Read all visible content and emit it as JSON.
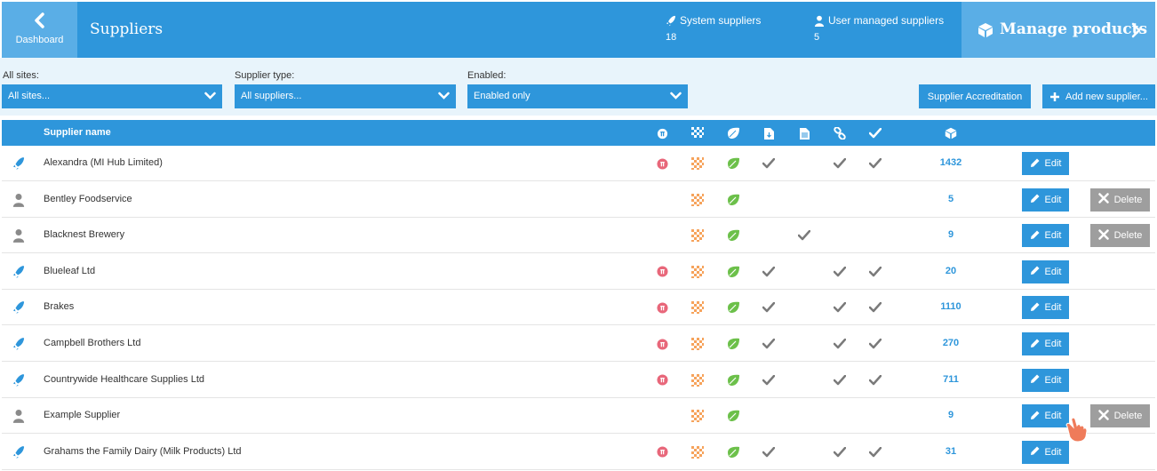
{
  "header": {
    "dashboard_label": "Dashboard",
    "title": "Suppliers",
    "system_suppliers_label": "System suppliers",
    "system_suppliers_count": "18",
    "user_suppliers_label": "User managed suppliers",
    "user_suppliers_count": "5",
    "manage_products_label": "Manage products"
  },
  "filters": {
    "sites_label": "All sites:",
    "sites_value": "All sites...",
    "type_label": "Supplier type:",
    "type_value": "All suppliers...",
    "enabled_label": "Enabled:",
    "enabled_value": "Enabled only",
    "accreditation_label": "Supplier Accreditation",
    "add_label": "Add new supplier..."
  },
  "table": {
    "name_header": "Supplier name",
    "edit_label": "Edit",
    "delete_label": "Delete",
    "rows": [
      {
        "name": "Alexandra (MI Hub Limited)",
        "type": "system",
        "count": "1432",
        "c1": true,
        "c2": true,
        "c3": true,
        "c4": true,
        "c5": false,
        "c6": true,
        "c7": true,
        "deletable": false
      },
      {
        "name": "Bentley Foodservice",
        "type": "user",
        "count": "5",
        "c1": false,
        "c2": true,
        "c3": true,
        "c4": false,
        "c5": false,
        "c6": false,
        "c7": false,
        "deletable": true
      },
      {
        "name": "Blacknest Brewery",
        "type": "user",
        "count": "9",
        "c1": false,
        "c2": true,
        "c3": true,
        "c4": false,
        "c5": true,
        "c6": false,
        "c7": false,
        "deletable": true
      },
      {
        "name": "Blueleaf Ltd",
        "type": "system",
        "count": "20",
        "c1": true,
        "c2": true,
        "c3": true,
        "c4": true,
        "c5": false,
        "c6": true,
        "c7": true,
        "deletable": false
      },
      {
        "name": "Brakes",
        "type": "system",
        "count": "1110",
        "c1": true,
        "c2": true,
        "c3": true,
        "c4": true,
        "c5": false,
        "c6": true,
        "c7": true,
        "deletable": false
      },
      {
        "name": "Campbell Brothers Ltd",
        "type": "system",
        "count": "270",
        "c1": true,
        "c2": true,
        "c3": true,
        "c4": true,
        "c5": false,
        "c6": true,
        "c7": true,
        "deletable": false
      },
      {
        "name": "Countrywide Healthcare Supplies Ltd",
        "type": "system",
        "count": "711",
        "c1": true,
        "c2": true,
        "c3": true,
        "c4": true,
        "c5": false,
        "c6": true,
        "c7": true,
        "deletable": false
      },
      {
        "name": "Example Supplier",
        "type": "user",
        "count": "9",
        "c1": false,
        "c2": true,
        "c3": true,
        "c4": false,
        "c5": false,
        "c6": false,
        "c7": false,
        "deletable": true
      },
      {
        "name": "Grahams the Family Dairy (Milk Products) Ltd",
        "type": "system",
        "count": "31",
        "c1": true,
        "c2": true,
        "c3": true,
        "c4": true,
        "c5": false,
        "c6": true,
        "c7": true,
        "deletable": false
      }
    ]
  },
  "colors": {
    "primary": "#2e96db",
    "primary_light": "#5aaee6",
    "delete_gray": "#9e9e9e",
    "allergen_red": "#e8677a",
    "checker_orange": "#f6a35c",
    "leaf_green": "#6cc04a",
    "check_gray": "#7a7a7a"
  },
  "icons": {
    "system_supplier": "rocket-icon",
    "user_supplier": "user-icon",
    "col1": "allergen-icon",
    "col2": "checker-icon",
    "col3": "leaf-icon",
    "col4": "download-doc-icon",
    "col5": "document-icon",
    "col6": "link-icon",
    "col7": "check-icon",
    "products": "box-icon"
  }
}
